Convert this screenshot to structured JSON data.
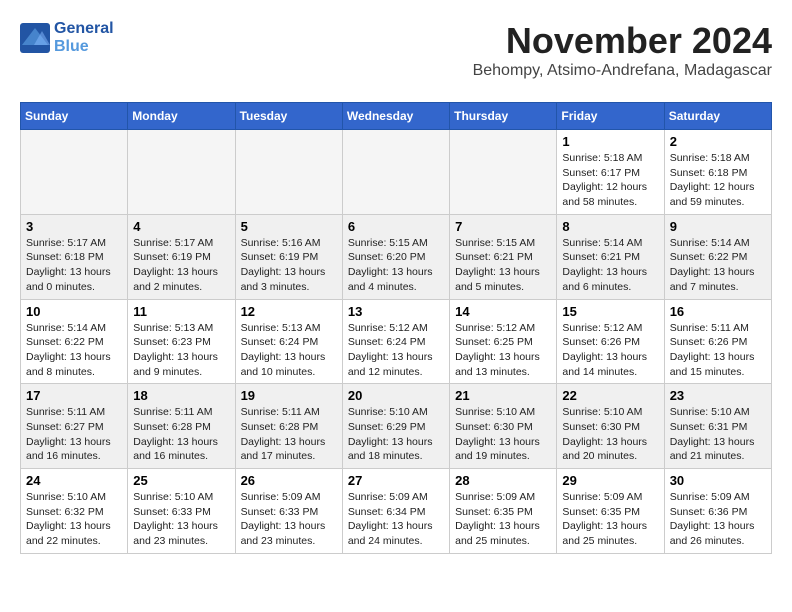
{
  "header": {
    "logo_line1": "General",
    "logo_line2": "Blue",
    "month_title": "November 2024",
    "location": "Behompy, Atsimo-Andrefana, Madagascar"
  },
  "weekdays": [
    "Sunday",
    "Monday",
    "Tuesday",
    "Wednesday",
    "Thursday",
    "Friday",
    "Saturday"
  ],
  "weeks": [
    [
      {
        "day": "",
        "info": ""
      },
      {
        "day": "",
        "info": ""
      },
      {
        "day": "",
        "info": ""
      },
      {
        "day": "",
        "info": ""
      },
      {
        "day": "",
        "info": ""
      },
      {
        "day": "1",
        "info": "Sunrise: 5:18 AM\nSunset: 6:17 PM\nDaylight: 12 hours\nand 58 minutes."
      },
      {
        "day": "2",
        "info": "Sunrise: 5:18 AM\nSunset: 6:18 PM\nDaylight: 12 hours\nand 59 minutes."
      }
    ],
    [
      {
        "day": "3",
        "info": "Sunrise: 5:17 AM\nSunset: 6:18 PM\nDaylight: 13 hours\nand 0 minutes."
      },
      {
        "day": "4",
        "info": "Sunrise: 5:17 AM\nSunset: 6:19 PM\nDaylight: 13 hours\nand 2 minutes."
      },
      {
        "day": "5",
        "info": "Sunrise: 5:16 AM\nSunset: 6:19 PM\nDaylight: 13 hours\nand 3 minutes."
      },
      {
        "day": "6",
        "info": "Sunrise: 5:15 AM\nSunset: 6:20 PM\nDaylight: 13 hours\nand 4 minutes."
      },
      {
        "day": "7",
        "info": "Sunrise: 5:15 AM\nSunset: 6:21 PM\nDaylight: 13 hours\nand 5 minutes."
      },
      {
        "day": "8",
        "info": "Sunrise: 5:14 AM\nSunset: 6:21 PM\nDaylight: 13 hours\nand 6 minutes."
      },
      {
        "day": "9",
        "info": "Sunrise: 5:14 AM\nSunset: 6:22 PM\nDaylight: 13 hours\nand 7 minutes."
      }
    ],
    [
      {
        "day": "10",
        "info": "Sunrise: 5:14 AM\nSunset: 6:22 PM\nDaylight: 13 hours\nand 8 minutes."
      },
      {
        "day": "11",
        "info": "Sunrise: 5:13 AM\nSunset: 6:23 PM\nDaylight: 13 hours\nand 9 minutes."
      },
      {
        "day": "12",
        "info": "Sunrise: 5:13 AM\nSunset: 6:24 PM\nDaylight: 13 hours\nand 10 minutes."
      },
      {
        "day": "13",
        "info": "Sunrise: 5:12 AM\nSunset: 6:24 PM\nDaylight: 13 hours\nand 12 minutes."
      },
      {
        "day": "14",
        "info": "Sunrise: 5:12 AM\nSunset: 6:25 PM\nDaylight: 13 hours\nand 13 minutes."
      },
      {
        "day": "15",
        "info": "Sunrise: 5:12 AM\nSunset: 6:26 PM\nDaylight: 13 hours\nand 14 minutes."
      },
      {
        "day": "16",
        "info": "Sunrise: 5:11 AM\nSunset: 6:26 PM\nDaylight: 13 hours\nand 15 minutes."
      }
    ],
    [
      {
        "day": "17",
        "info": "Sunrise: 5:11 AM\nSunset: 6:27 PM\nDaylight: 13 hours\nand 16 minutes."
      },
      {
        "day": "18",
        "info": "Sunrise: 5:11 AM\nSunset: 6:28 PM\nDaylight: 13 hours\nand 16 minutes."
      },
      {
        "day": "19",
        "info": "Sunrise: 5:11 AM\nSunset: 6:28 PM\nDaylight: 13 hours\nand 17 minutes."
      },
      {
        "day": "20",
        "info": "Sunrise: 5:10 AM\nSunset: 6:29 PM\nDaylight: 13 hours\nand 18 minutes."
      },
      {
        "day": "21",
        "info": "Sunrise: 5:10 AM\nSunset: 6:30 PM\nDaylight: 13 hours\nand 19 minutes."
      },
      {
        "day": "22",
        "info": "Sunrise: 5:10 AM\nSunset: 6:30 PM\nDaylight: 13 hours\nand 20 minutes."
      },
      {
        "day": "23",
        "info": "Sunrise: 5:10 AM\nSunset: 6:31 PM\nDaylight: 13 hours\nand 21 minutes."
      }
    ],
    [
      {
        "day": "24",
        "info": "Sunrise: 5:10 AM\nSunset: 6:32 PM\nDaylight: 13 hours\nand 22 minutes."
      },
      {
        "day": "25",
        "info": "Sunrise: 5:10 AM\nSunset: 6:33 PM\nDaylight: 13 hours\nand 23 minutes."
      },
      {
        "day": "26",
        "info": "Sunrise: 5:09 AM\nSunset: 6:33 PM\nDaylight: 13 hours\nand 23 minutes."
      },
      {
        "day": "27",
        "info": "Sunrise: 5:09 AM\nSunset: 6:34 PM\nDaylight: 13 hours\nand 24 minutes."
      },
      {
        "day": "28",
        "info": "Sunrise: 5:09 AM\nSunset: 6:35 PM\nDaylight: 13 hours\nand 25 minutes."
      },
      {
        "day": "29",
        "info": "Sunrise: 5:09 AM\nSunset: 6:35 PM\nDaylight: 13 hours\nand 25 minutes."
      },
      {
        "day": "30",
        "info": "Sunrise: 5:09 AM\nSunset: 6:36 PM\nDaylight: 13 hours\nand 26 minutes."
      }
    ]
  ]
}
